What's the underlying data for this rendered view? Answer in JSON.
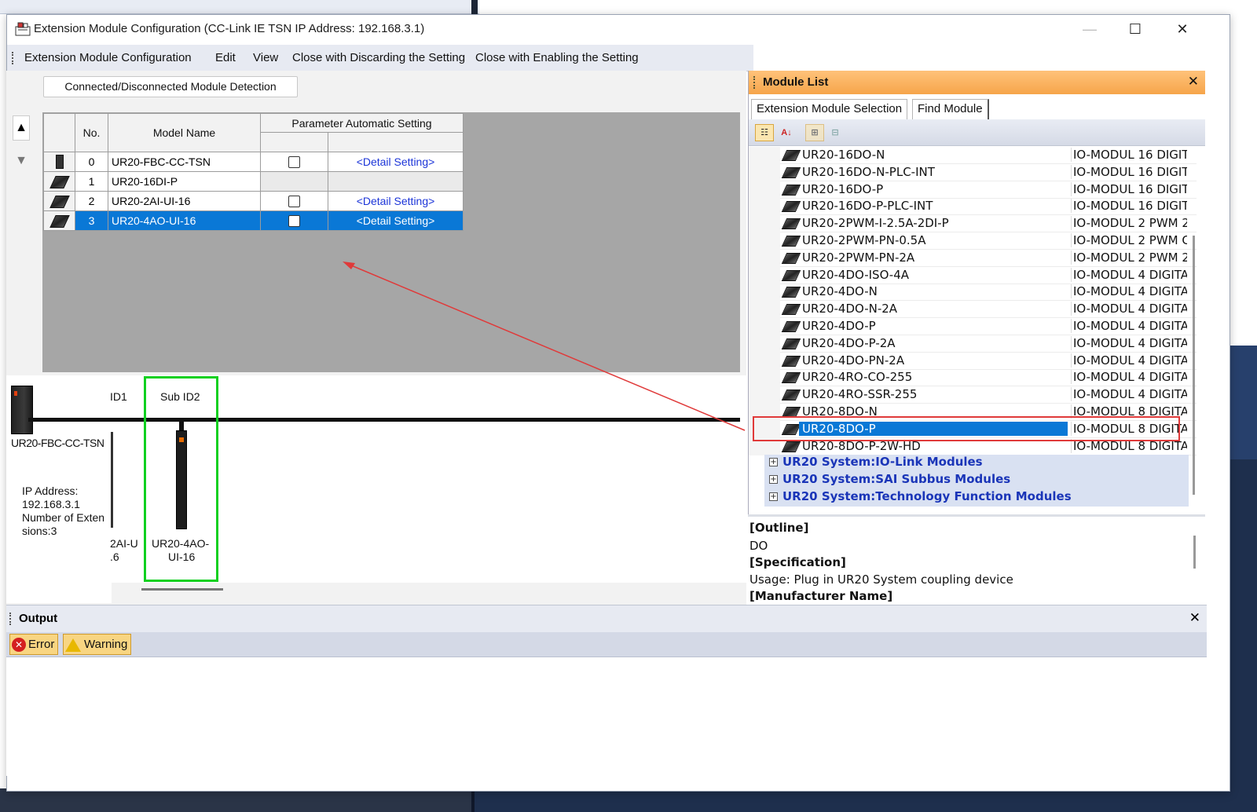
{
  "window": {
    "title": "Extension Module Configuration (CC-Link IE TSN IP Address: 192.168.3.1)",
    "controls": {
      "minimize": "—",
      "maximize": "☐",
      "close": "✕"
    }
  },
  "menu": {
    "items": [
      "Extension Module Configuration",
      "Edit",
      "View",
      "Close with Discarding the Setting",
      "Close with Enabling the Setting"
    ]
  },
  "toolbar": {
    "detect_button": "Connected/Disconnected Module Detection"
  },
  "module_table": {
    "headers": {
      "no": "No.",
      "model": "Model Name",
      "param": "Parameter Automatic Setting"
    },
    "rows": [
      {
        "no": "0",
        "model": "UR20-FBC-CC-TSN",
        "checkbox": true,
        "detail": "<Detail Setting>",
        "selected": false
      },
      {
        "no": "1",
        "model": "UR20-16DI-P",
        "checkbox": false,
        "detail": "",
        "selected": false
      },
      {
        "no": "2",
        "model": "UR20-2AI-UI-16",
        "checkbox": true,
        "detail": "<Detail Setting>",
        "selected": false
      },
      {
        "no": "3",
        "model": "UR20-4AO-UI-16",
        "checkbox": true,
        "detail": "<Detail Setting>",
        "selected": true
      }
    ]
  },
  "diagram": {
    "id1_label": "ID1",
    "subid2_label": "Sub ID2",
    "device_label": "UR20-FBC-CC-TSN",
    "ip_label": "IP Address:",
    "ip_value": "192.168.3.1",
    "ext_label_1": "Number of Exten",
    "ext_label_2": "sions:3",
    "partial_label_1": "2AI-U",
    "partial_label_2": ".6",
    "ao_label_1": "UR20-4AO-",
    "ao_label_2": "UI-16",
    "highlight_color": "#10d020"
  },
  "module_list": {
    "title": "Module List",
    "tabs": [
      "Extension Module Selection",
      "Find Module"
    ],
    "items": [
      {
        "name": "UR20-16DO-N",
        "desc": "IO-MODUL 16 DIGIT"
      },
      {
        "name": "UR20-16DO-N-PLC-INT",
        "desc": "IO-MODUL 16 DIGIT"
      },
      {
        "name": "UR20-16DO-P",
        "desc": "IO-MODUL 16 DIGIT"
      },
      {
        "name": "UR20-16DO-P-PLC-INT",
        "desc": "IO-MODUL 16 DIGIT"
      },
      {
        "name": "UR20-2PWM-I-2.5A-2DI-P",
        "desc": "IO-MODUL 2 PWM 2"
      },
      {
        "name": "UR20-2PWM-PN-0.5A",
        "desc": "IO-MODUL 2 PWM C"
      },
      {
        "name": "UR20-2PWM-PN-2A",
        "desc": "IO-MODUL 2 PWM 2"
      },
      {
        "name": "UR20-4DO-ISO-4A",
        "desc": "IO-MODUL 4 DIGITA"
      },
      {
        "name": "UR20-4DO-N",
        "desc": "IO-MODUL 4 DIGITA"
      },
      {
        "name": "UR20-4DO-N-2A",
        "desc": "IO-MODUL 4 DIGITA"
      },
      {
        "name": "UR20-4DO-P",
        "desc": "IO-MODUL 4 DIGITA"
      },
      {
        "name": "UR20-4DO-P-2A",
        "desc": "IO-MODUL 4 DIGITA"
      },
      {
        "name": "UR20-4DO-PN-2A",
        "desc": "IO-MODUL 4 DIGITA"
      },
      {
        "name": "UR20-4RO-CO-255",
        "desc": "IO-MODUL 4 DIGITA"
      },
      {
        "name": "UR20-4RO-SSR-255",
        "desc": "IO-MODUL 4 DIGITA"
      },
      {
        "name": "UR20-8DO-N",
        "desc": "IO-MODUL 8 DIGITA"
      },
      {
        "name": "UR20-8DO-P",
        "desc": "IO-MODUL 8 DIGITA",
        "selected": true
      },
      {
        "name": "UR20-8DO-P-2W-HD",
        "desc": "IO-MODUL 8 DIGITA"
      }
    ],
    "groups": [
      "UR20 System:IO-Link Modules",
      "UR20 System:SAI Subbus Modules",
      "UR20 System:Technology Function Modules"
    ],
    "info": {
      "outline_head": "[Outline]",
      "outline": "DO",
      "spec_head": "[Specification]",
      "spec": "Usage: Plug in UR20 System coupling device",
      "maker_head": "[Manufacturer Name]"
    }
  },
  "output": {
    "title": "Output",
    "error_label": "Error",
    "warning_label": "Warning"
  },
  "colors": {
    "selection": "#0a78d6",
    "module_list_header": "#f6a54a",
    "annotation_arrow": "#e03a3a"
  }
}
